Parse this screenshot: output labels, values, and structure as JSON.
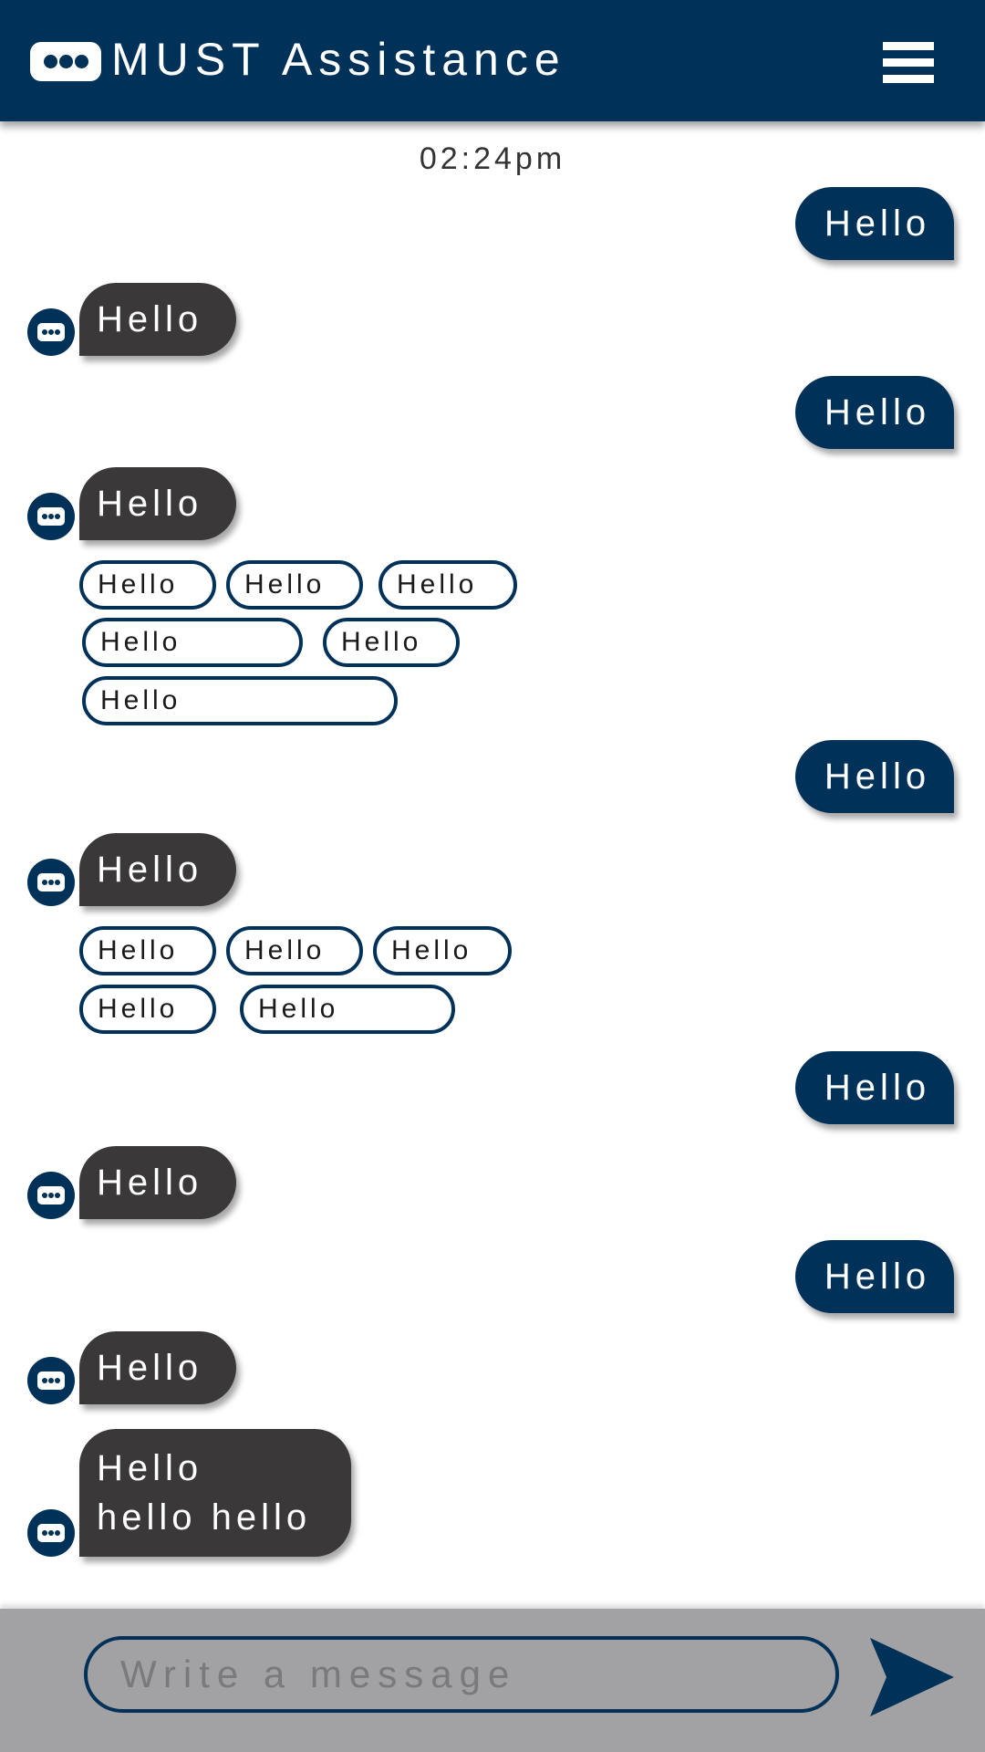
{
  "header": {
    "title": "MUST Assistance",
    "logo_icon": "chat-bubble-icon",
    "menu_icon": "hamburger-menu-icon",
    "background_color": "#003158"
  },
  "chat": {
    "timestamp": "02:24pm",
    "user_bubble_color": "#003158",
    "bot_bubble_color": "#3a3838",
    "messages": [
      {
        "sender": "user",
        "text": "Hello"
      },
      {
        "sender": "bot",
        "text": "Hello"
      },
      {
        "sender": "user",
        "text": "Hello"
      },
      {
        "sender": "bot",
        "text": "Hello",
        "quick_replies": [
          "Hello",
          "Hello",
          "Hello",
          "Hello",
          "Hello",
          "Hello"
        ]
      },
      {
        "sender": "user",
        "text": "Hello"
      },
      {
        "sender": "bot",
        "text": "Hello",
        "quick_replies": [
          "Hello",
          "Hello",
          "Hello",
          "Hello",
          "Hello"
        ]
      },
      {
        "sender": "user",
        "text": "Hello"
      },
      {
        "sender": "bot",
        "text": "Hello"
      },
      {
        "sender": "user",
        "text": "Hello"
      },
      {
        "sender": "bot",
        "text": "Hello"
      },
      {
        "sender": "bot",
        "line1": "Hello",
        "line2": "hello hello"
      }
    ]
  },
  "composer": {
    "placeholder": "Write a message",
    "value": "",
    "send_icon": "send-arrow-icon",
    "background_color": "#a2a1a3"
  }
}
